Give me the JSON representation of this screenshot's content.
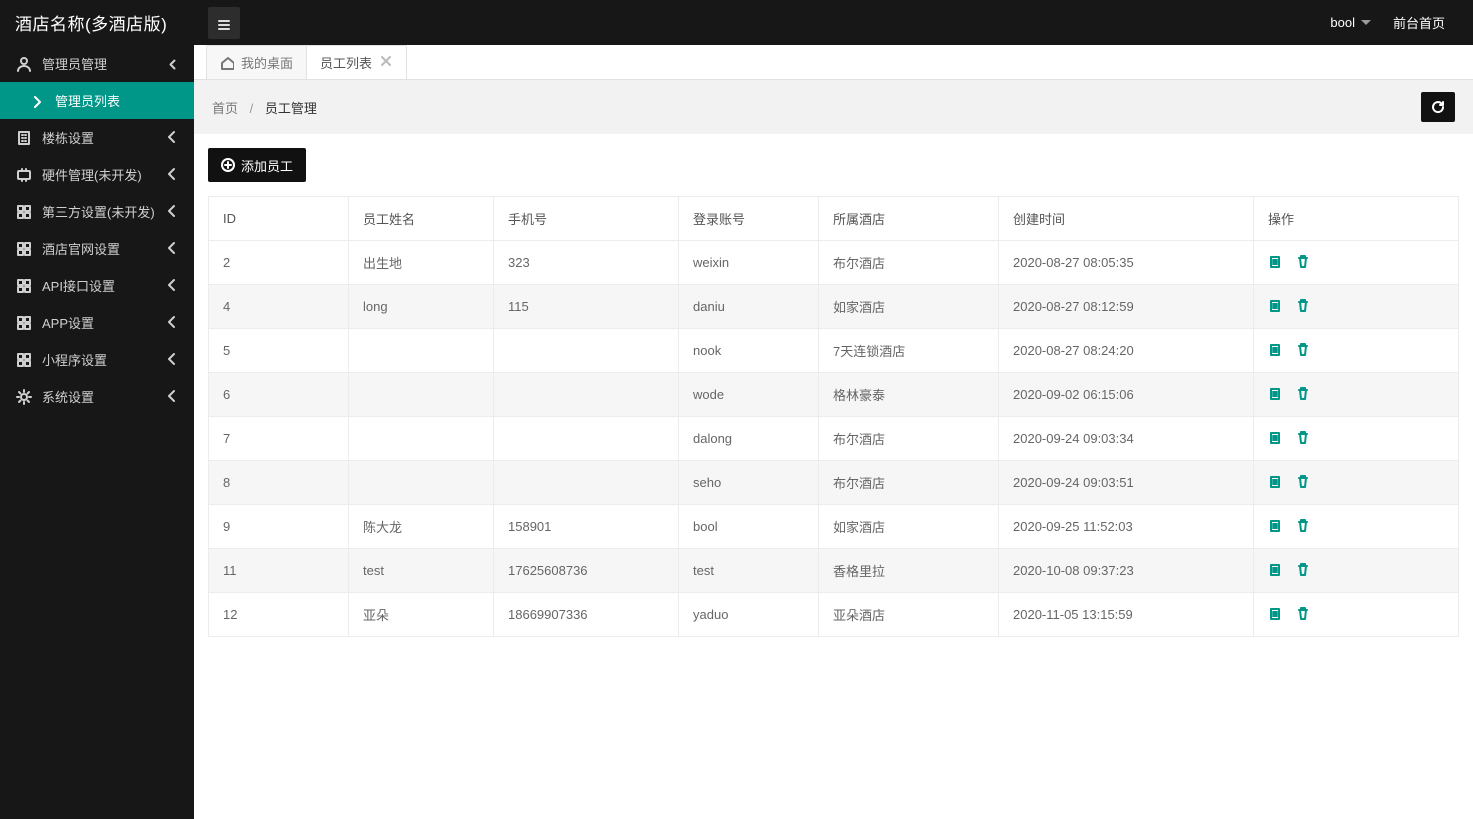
{
  "brand": "酒店名称(多酒店版)",
  "user": "bool",
  "top_link_front": "前台首页",
  "sidebar": {
    "items": [
      {
        "icon": "user-admin",
        "label": "管理员管理",
        "expanded": true,
        "children": [
          {
            "label": "管理员列表"
          }
        ]
      },
      {
        "icon": "building",
        "label": "楼栋设置"
      },
      {
        "icon": "hardware",
        "label": "硬件管理(未开发)"
      },
      {
        "icon": "grid",
        "label": "第三方设置(未开发)"
      },
      {
        "icon": "grid",
        "label": "酒店官网设置"
      },
      {
        "icon": "grid",
        "label": "API接口设置"
      },
      {
        "icon": "grid",
        "label": "APP设置"
      },
      {
        "icon": "grid",
        "label": "小程序设置"
      },
      {
        "icon": "gear",
        "label": "系统设置"
      }
    ]
  },
  "tabs": [
    {
      "label": "我的桌面",
      "closable": false,
      "active": false
    },
    {
      "label": "员工列表",
      "closable": true,
      "active": true
    }
  ],
  "breadcrumb": {
    "root": "首页",
    "current": "员工管理"
  },
  "add_button": "添加员工",
  "table": {
    "headers": [
      "ID",
      "员工姓名",
      "手机号",
      "登录账号",
      "所属酒店",
      "创建时间",
      "操作"
    ],
    "rows": [
      {
        "id": "2",
        "name": "出生地",
        "phone": "323",
        "acct": "weixin",
        "hotel": "布尔酒店",
        "time": "2020-08-27 08:05:35"
      },
      {
        "id": "4",
        "name": "long",
        "phone": "115",
        "acct": "daniu",
        "hotel": "如家酒店",
        "time": "2020-08-27 08:12:59"
      },
      {
        "id": "5",
        "name": "",
        "phone": "",
        "acct": "nook",
        "hotel": "7天连锁酒店",
        "time": "2020-08-27 08:24:20"
      },
      {
        "id": "6",
        "name": "",
        "phone": "",
        "acct": "wode",
        "hotel": "格林豪泰",
        "time": "2020-09-02 06:15:06"
      },
      {
        "id": "7",
        "name": "",
        "phone": "",
        "acct": "dalong",
        "hotel": "布尔酒店",
        "time": "2020-09-24 09:03:34"
      },
      {
        "id": "8",
        "name": "",
        "phone": "",
        "acct": "seho",
        "hotel": "布尔酒店",
        "time": "2020-09-24 09:03:51"
      },
      {
        "id": "9",
        "name": "陈大龙",
        "phone": "158901",
        "acct": "bool",
        "hotel": "如家酒店",
        "time": "2020-09-25 11:52:03"
      },
      {
        "id": "11",
        "name": "test",
        "phone": "17625608736",
        "acct": "test",
        "hotel": "香格里拉",
        "time": "2020-10-08 09:37:23"
      },
      {
        "id": "12",
        "name": "亚朵",
        "phone": "18669907336",
        "acct": "yaduo",
        "hotel": "亚朵酒店",
        "time": "2020-11-05 13:15:59"
      }
    ]
  }
}
